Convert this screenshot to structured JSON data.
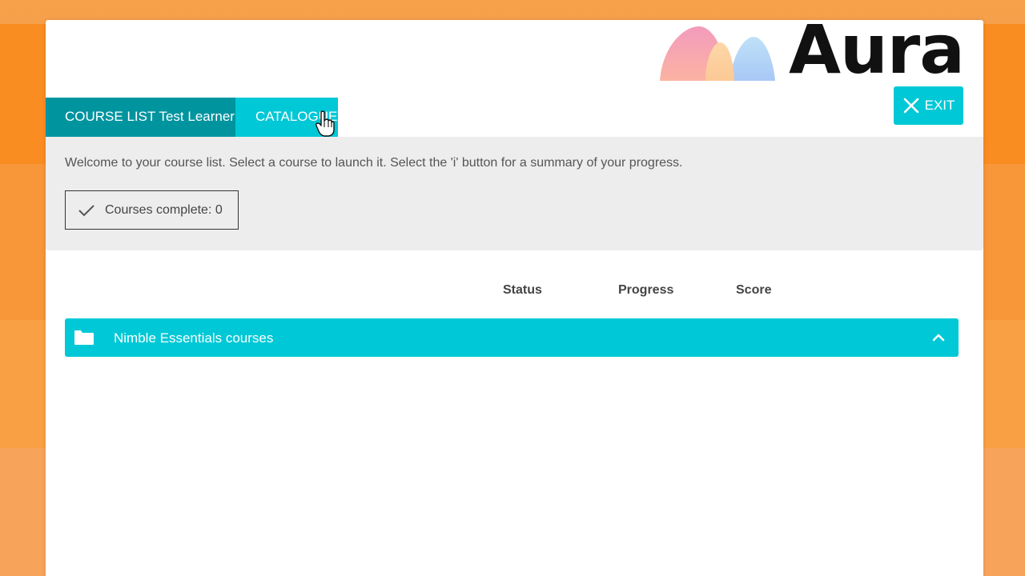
{
  "brand": {
    "name": "Aura",
    "colors": {
      "pink": "#f7a6b4",
      "peach": "#fcd4a0",
      "blue": "#aed0f5"
    }
  },
  "header": {
    "exit_label": "EXIT"
  },
  "tabs": [
    {
      "label": "COURSE LIST Test Learner",
      "active": true
    },
    {
      "label": "CATALOGUE",
      "active": false
    }
  ],
  "welcome": {
    "text": "Welcome to your course list. Select a course to launch it. Select the 'i' button for a summary of your progress.",
    "courses_complete": "Courses complete: 0"
  },
  "table": {
    "columns": [
      "Status",
      "Progress",
      "Score"
    ],
    "groups": [
      {
        "label": "Nimble Essentials courses",
        "expanded": true
      }
    ]
  },
  "colors": {
    "accent": "#00c8d6",
    "accent_dark": "#00949f",
    "background": "#f98d22"
  },
  "icons": {
    "exit": "close-icon",
    "complete": "check-icon",
    "group": "folder-icon",
    "toggle": "chevron-up-icon"
  }
}
